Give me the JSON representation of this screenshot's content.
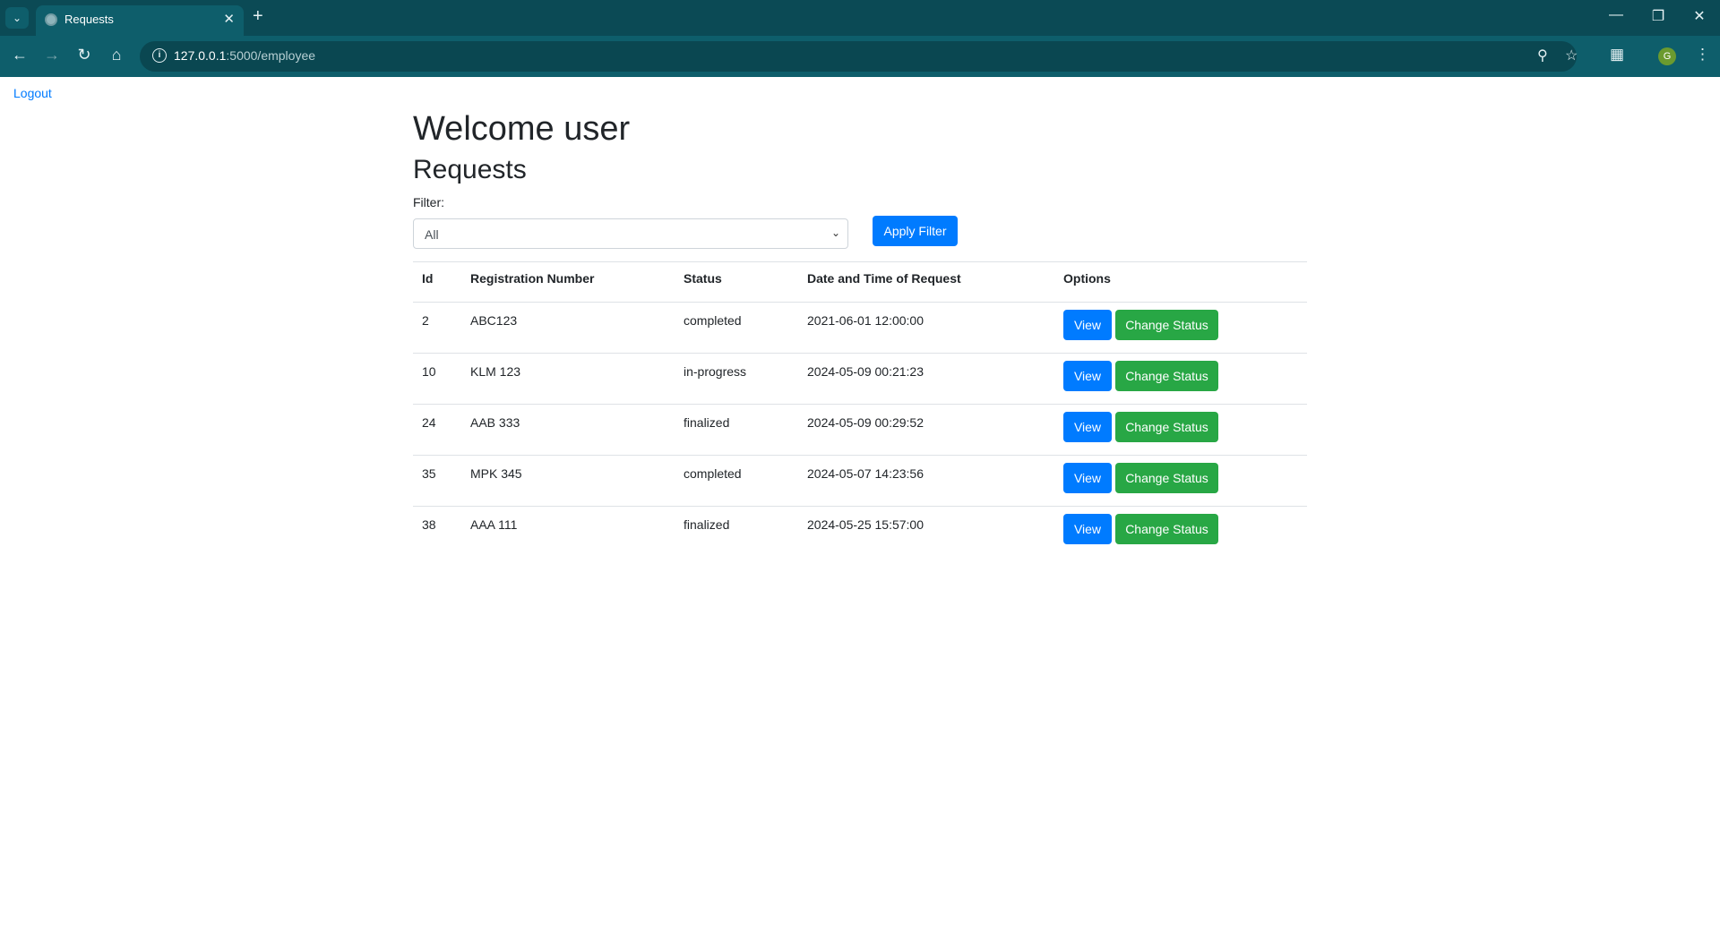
{
  "browser": {
    "tab_title": "Requests",
    "url_host": "127.0.0.1",
    "url_rest": ":5000/employee",
    "avatar_letter": "G"
  },
  "nav": {
    "logout_label": "Logout"
  },
  "header": {
    "welcome": "Welcome user",
    "section_title": "Requests"
  },
  "filter": {
    "label": "Filter:",
    "selected": "All",
    "apply_label": "Apply Filter"
  },
  "table": {
    "columns": [
      "Id",
      "Registration Number",
      "Status",
      "Date and Time of Request",
      "Options"
    ],
    "rows": [
      {
        "id": "2",
        "reg": "ABC123",
        "status": "completed",
        "datetime": "2021-06-01 12:00:00"
      },
      {
        "id": "10",
        "reg": "KLM 123",
        "status": "in-progress",
        "datetime": "2024-05-09 00:21:23"
      },
      {
        "id": "24",
        "reg": "AAB 333",
        "status": "finalized",
        "datetime": "2024-05-09 00:29:52"
      },
      {
        "id": "35",
        "reg": "MPK 345",
        "status": "completed",
        "datetime": "2024-05-07 14:23:56"
      },
      {
        "id": "38",
        "reg": "AAA 111",
        "status": "finalized",
        "datetime": "2024-05-25 15:57:00"
      }
    ],
    "view_label": "View",
    "change_label": "Change Status"
  },
  "colors": {
    "primary": "#007bff",
    "success": "#28a745",
    "chrome": "#0e5e6b"
  }
}
